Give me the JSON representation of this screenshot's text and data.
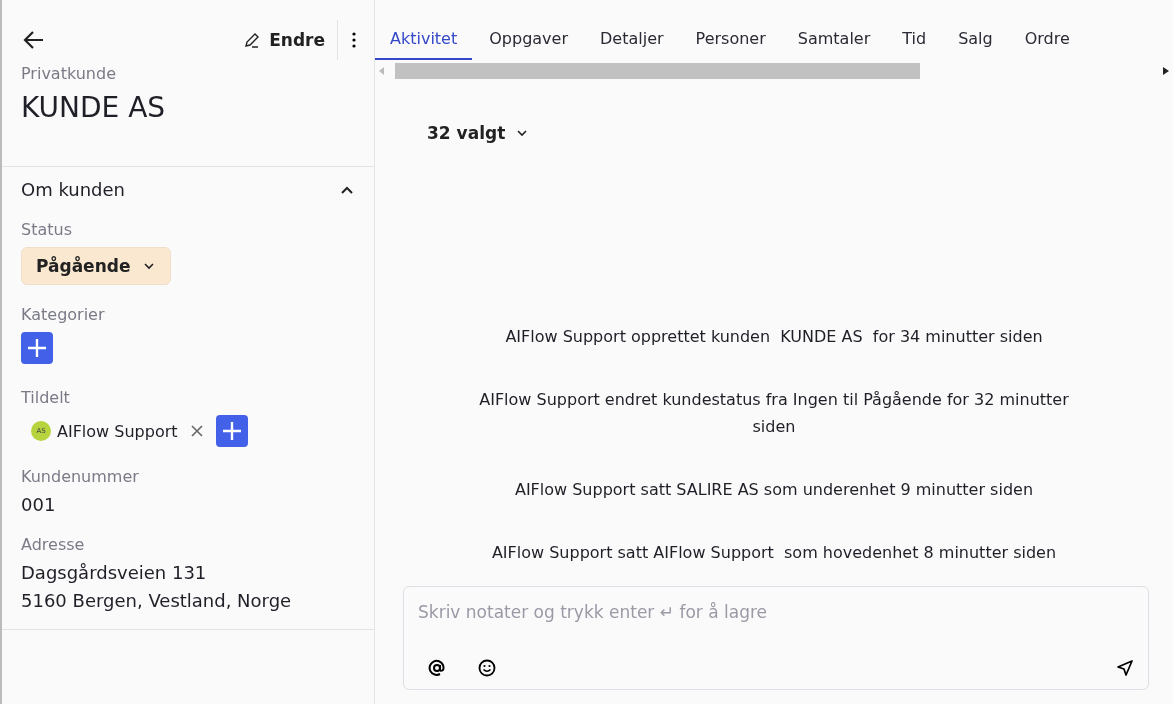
{
  "header": {
    "edit_label": "Endre"
  },
  "customer": {
    "type": "Privatkunde",
    "name": "KUNDE AS"
  },
  "section": {
    "title": "Om kunden",
    "expanded": true
  },
  "fields": [
    {
      "kind": "status",
      "label": "Status",
      "value": "Pågående"
    },
    {
      "kind": "add",
      "label": "Kategorier"
    },
    {
      "kind": "assignee",
      "label": "Tildelt",
      "initials": "AS",
      "name": "AIFlow Support"
    },
    {
      "kind": "text",
      "label": "Kundenummer",
      "lines": [
        "001"
      ]
    },
    {
      "kind": "text",
      "label": "Adresse",
      "lines": [
        "Dagsgårdsveien 131",
        "5160 Bergen, Vestland, Norge"
      ]
    }
  ],
  "tabs": [
    {
      "label": "Aktivitet",
      "selected": true
    },
    {
      "label": "Oppgaver",
      "selected": false
    },
    {
      "label": "Detaljer",
      "selected": false
    },
    {
      "label": "Personer",
      "selected": false
    },
    {
      "label": "Samtaler",
      "selected": false
    },
    {
      "label": "Tid",
      "selected": false
    },
    {
      "label": "Salg",
      "selected": false
    },
    {
      "label": "Ordre",
      "selected": false
    }
  ],
  "filter": {
    "label": "32 valgt"
  },
  "activity": [
    "AIFlow Support opprettet kunden  KUNDE AS  for 34 minutter siden",
    "AIFlow Support endret kundestatus fra Ingen til Pågående for 32 minutter siden",
    "AIFlow Support satt SALIRE AS som underenhet 9 minutter siden",
    "AIFlow Support satt AIFlow Support  som hovedenhet 8 minutter siden"
  ],
  "note": {
    "placeholder": "Skriv notater og trykk enter ↵ for å lagre"
  }
}
